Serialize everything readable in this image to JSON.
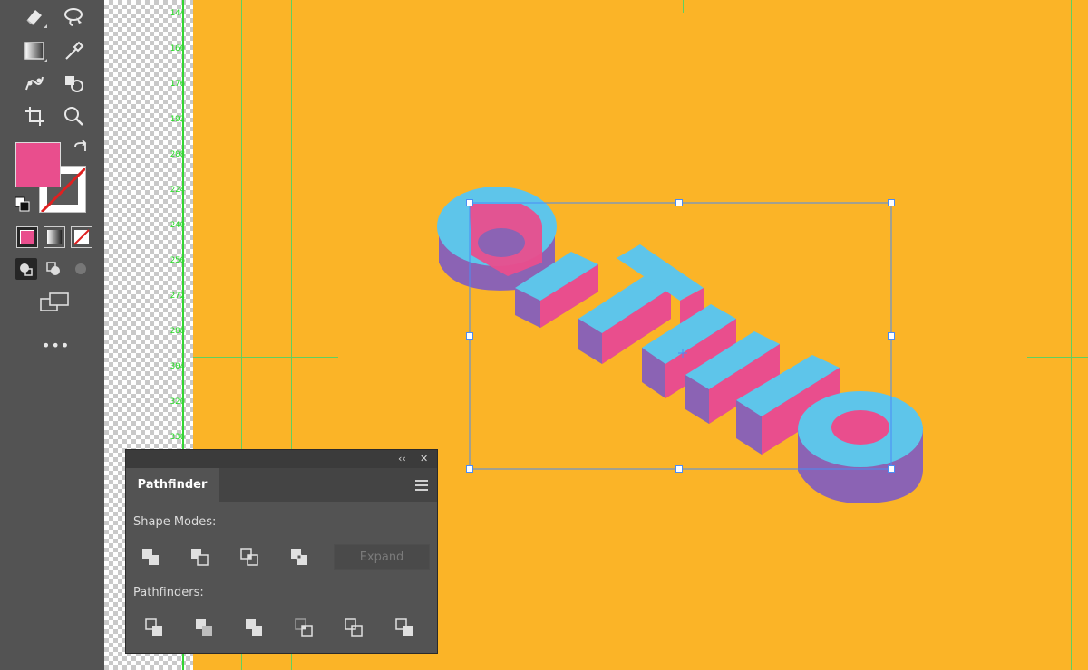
{
  "toolbar": {
    "tools": [
      {
        "name": "eraser-tool",
        "icon": "eraser-icon"
      },
      {
        "name": "lasso-tool",
        "icon": "lasso-icon"
      },
      {
        "name": "gradient-tool",
        "icon": "gradient-icon"
      },
      {
        "name": "eyedropper-tool",
        "icon": "eyedropper-icon"
      },
      {
        "name": "puppet-warp-tool",
        "icon": "puppet-warp-icon"
      },
      {
        "name": "shape-builder-tool",
        "icon": "shape-builder-icon"
      },
      {
        "name": "artboard-tool",
        "icon": "artboard-icon"
      },
      {
        "name": "zoom-tool",
        "icon": "zoom-icon"
      }
    ],
    "fill_color": "#e94e8d",
    "stroke_color": "none",
    "more_tools_label": "•••"
  },
  "ruler": {
    "ticks": [
      "144",
      "160",
      "176",
      "192",
      "208",
      "224",
      "240",
      "256",
      "272",
      "288",
      "304",
      "320",
      "336"
    ]
  },
  "canvas": {
    "background": "#fbb427",
    "artwork_text": "GITHO",
    "artwork_colors": {
      "top": "#5ec5ea",
      "side": "#8b63b4",
      "front": "#e94e8d"
    }
  },
  "pathfinder": {
    "title": "Pathfinder",
    "collapse_label": "‹‹",
    "close_label": "✕",
    "shape_modes_label": "Shape Modes:",
    "pathfinders_label": "Pathfinders:",
    "expand_label": "Expand",
    "shape_modes": [
      "unite",
      "minus-front",
      "intersect",
      "exclude"
    ],
    "pathfinder_ops": [
      "divide",
      "trim",
      "merge",
      "crop",
      "outline",
      "minus-back"
    ]
  }
}
